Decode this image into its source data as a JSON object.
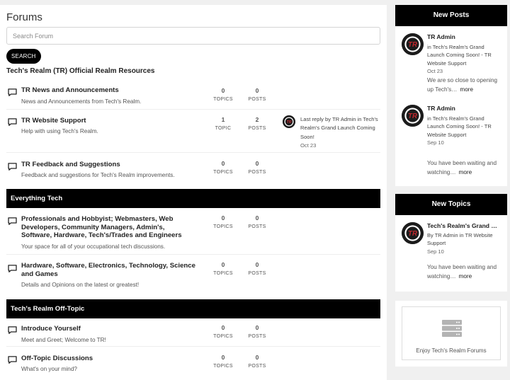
{
  "page": {
    "title": "Forums"
  },
  "search": {
    "placeholder": "Search Forum",
    "button_label": "SEARCH"
  },
  "categories": [
    {
      "name": "Tech's Realm (TR) Official Realm Resources",
      "forums": [
        {
          "title": "TR News and Announcements",
          "desc": "News and Announcements from Tech's Realm.",
          "topics": "0",
          "posts": "0"
        },
        {
          "title": "TR Website Support",
          "desc": "Help with using Tech's Realm.",
          "topics": "1",
          "posts": "2",
          "last_reply": {
            "prefix": "Last reply by",
            "author": "TR Admin",
            "in": "in",
            "topic": "Tech's Realm's Grand Launch Coming Soon!",
            "date": "Oct 23"
          }
        },
        {
          "title": "TR Feedback and Suggestions",
          "desc": "Feedback and suggestions for Tech's Realm improvements.",
          "topics": "0",
          "posts": "0"
        }
      ]
    },
    {
      "name": "Everything Tech",
      "forums": [
        {
          "title": "Professionals and Hobbyist; Webmasters, Web Developers, Community Managers, Admin's, Software, Hardware, Tech's/Trades and Engineers",
          "desc": "Your space for all of your occupational tech discussions.",
          "topics": "0",
          "posts": "0"
        },
        {
          "title": "Hardware, Software, Electronics, Technology, Science and Games",
          "desc": "Details and Opinions on the latest or greatest!",
          "topics": "0",
          "posts": "0"
        }
      ]
    },
    {
      "name": "Tech's Realm Off-Topic",
      "forums": [
        {
          "title": "Introduce Yourself",
          "desc": "Meet and Greet; Welcome to TR!",
          "topics": "0",
          "posts": "0"
        },
        {
          "title": "Off-Topic Discussions",
          "desc": "What's on your mind?",
          "topics": "0",
          "posts": "0"
        }
      ]
    }
  ],
  "labels": {
    "topics": "TOPICS",
    "topic": "TOPIC",
    "posts": "POSTS",
    "more": "more"
  },
  "new_posts": {
    "title": "New Posts",
    "items": [
      {
        "author": "TR Admin",
        "in": "in",
        "topic": "Tech's Realm's Grand Launch Coming Soon!",
        "sep": " - ",
        "forum": "TR Website Support",
        "date": "Oct 23",
        "excerpt": "We are so close to opening up Tech's…"
      },
      {
        "author": "TR Admin",
        "in": "in",
        "topic": "Tech's Realm's Grand Launch Coming Soon!",
        "sep": " - ",
        "forum": "TR Website Support",
        "date": "Sep 10",
        "excerpt": "You have been waiting and watching…"
      }
    ]
  },
  "new_topics": {
    "title": "New Topics",
    "items": [
      {
        "topic": "Tech's Realm's Grand Launch Coming Soon!",
        "by": "By",
        "author": "TR Admin",
        "in": "in",
        "forum": "TR Website Support",
        "date": "Sep 10",
        "excerpt": "You have been waiting and watching…"
      }
    ]
  },
  "widget": {
    "text": "Enjoy Tech's Realm Forums"
  },
  "colors": {
    "header_bg": "#000000",
    "accent": "#c1272d",
    "avatar_bg": "#1c1c1c"
  }
}
